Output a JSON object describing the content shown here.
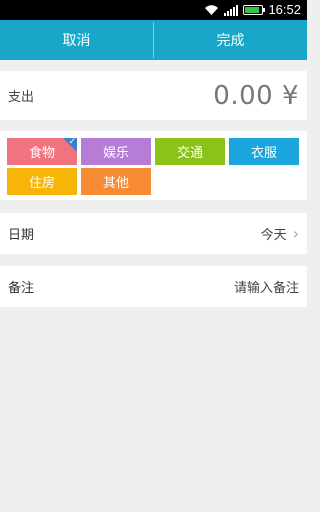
{
  "status_bar": {
    "time": "16:52",
    "battery_level": 0.9,
    "icons": [
      "wifi-icon",
      "signal-icon",
      "battery-icon"
    ]
  },
  "topbar": {
    "cancel_label": "取消",
    "done_label": "完成",
    "color": "#18a7c9"
  },
  "amount": {
    "label": "支出",
    "value": "0.00 ¥"
  },
  "categories": [
    {
      "label": "食物",
      "color": "#f0737f",
      "selected": true
    },
    {
      "label": "娱乐",
      "color": "#b77cd6",
      "selected": false
    },
    {
      "label": "交通",
      "color": "#8cc31a",
      "selected": false
    },
    {
      "label": "衣服",
      "color": "#1aa5dd",
      "selected": false
    },
    {
      "label": "住房",
      "color": "#f7b50a",
      "selected": false
    },
    {
      "label": "其他",
      "color": "#f68b34",
      "selected": false
    }
  ],
  "date": {
    "label": "日期",
    "value": "今天"
  },
  "note": {
    "label": "备注",
    "placeholder": "请输入备注"
  }
}
